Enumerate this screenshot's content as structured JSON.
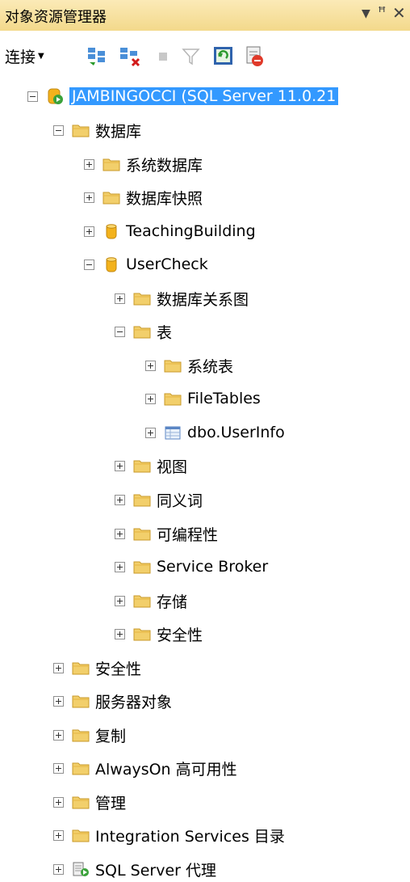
{
  "panel": {
    "title": "对象资源管理器",
    "dropdown_glyph": "▼",
    "pin_glyph": "ꟸ",
    "close_glyph": "✕"
  },
  "toolbar": {
    "connect_label": "连接",
    "connect_arrow": "▼"
  },
  "tree": [
    {
      "label": "JAMBINGOCCI (SQL Server 11.0.21",
      "icon": "server-icon",
      "expanded": true,
      "selected": true
    },
    {
      "label": "数据库",
      "icon": "folder-icon",
      "expanded": true
    },
    {
      "label": "系统数据库",
      "icon": "folder-icon",
      "expanded": false
    },
    {
      "label": "数据库快照",
      "icon": "folder-icon",
      "expanded": false
    },
    {
      "label": "TeachingBuilding",
      "icon": "database-icon",
      "expanded": false
    },
    {
      "label": "UserCheck",
      "icon": "database-icon",
      "expanded": true
    },
    {
      "label": "数据库关系图",
      "icon": "folder-icon",
      "expanded": false
    },
    {
      "label": "表",
      "icon": "folder-icon",
      "expanded": true
    },
    {
      "label": "系统表",
      "icon": "folder-icon",
      "expanded": false
    },
    {
      "label": "FileTables",
      "icon": "folder-icon",
      "expanded": false
    },
    {
      "label": "dbo.UserInfo",
      "icon": "table-icon",
      "expanded": false
    },
    {
      "label": "视图",
      "icon": "folder-icon",
      "expanded": false
    },
    {
      "label": "同义词",
      "icon": "folder-icon",
      "expanded": false
    },
    {
      "label": "可编程性",
      "icon": "folder-icon",
      "expanded": false
    },
    {
      "label": "Service Broker",
      "icon": "folder-icon",
      "expanded": false
    },
    {
      "label": "存储",
      "icon": "folder-icon",
      "expanded": false
    },
    {
      "label": "安全性",
      "icon": "folder-icon",
      "expanded": false
    },
    {
      "label": "安全性",
      "icon": "folder-icon",
      "expanded": false
    },
    {
      "label": "服务器对象",
      "icon": "folder-icon",
      "expanded": false
    },
    {
      "label": "复制",
      "icon": "folder-icon",
      "expanded": false
    },
    {
      "label": "AlwaysOn 高可用性",
      "icon": "folder-icon",
      "expanded": false
    },
    {
      "label": "管理",
      "icon": "folder-icon",
      "expanded": false
    },
    {
      "label": "Integration Services 目录",
      "icon": "folder-icon",
      "expanded": false
    },
    {
      "label": "SQL Server 代理",
      "icon": "agent-icon",
      "expanded": false
    }
  ]
}
